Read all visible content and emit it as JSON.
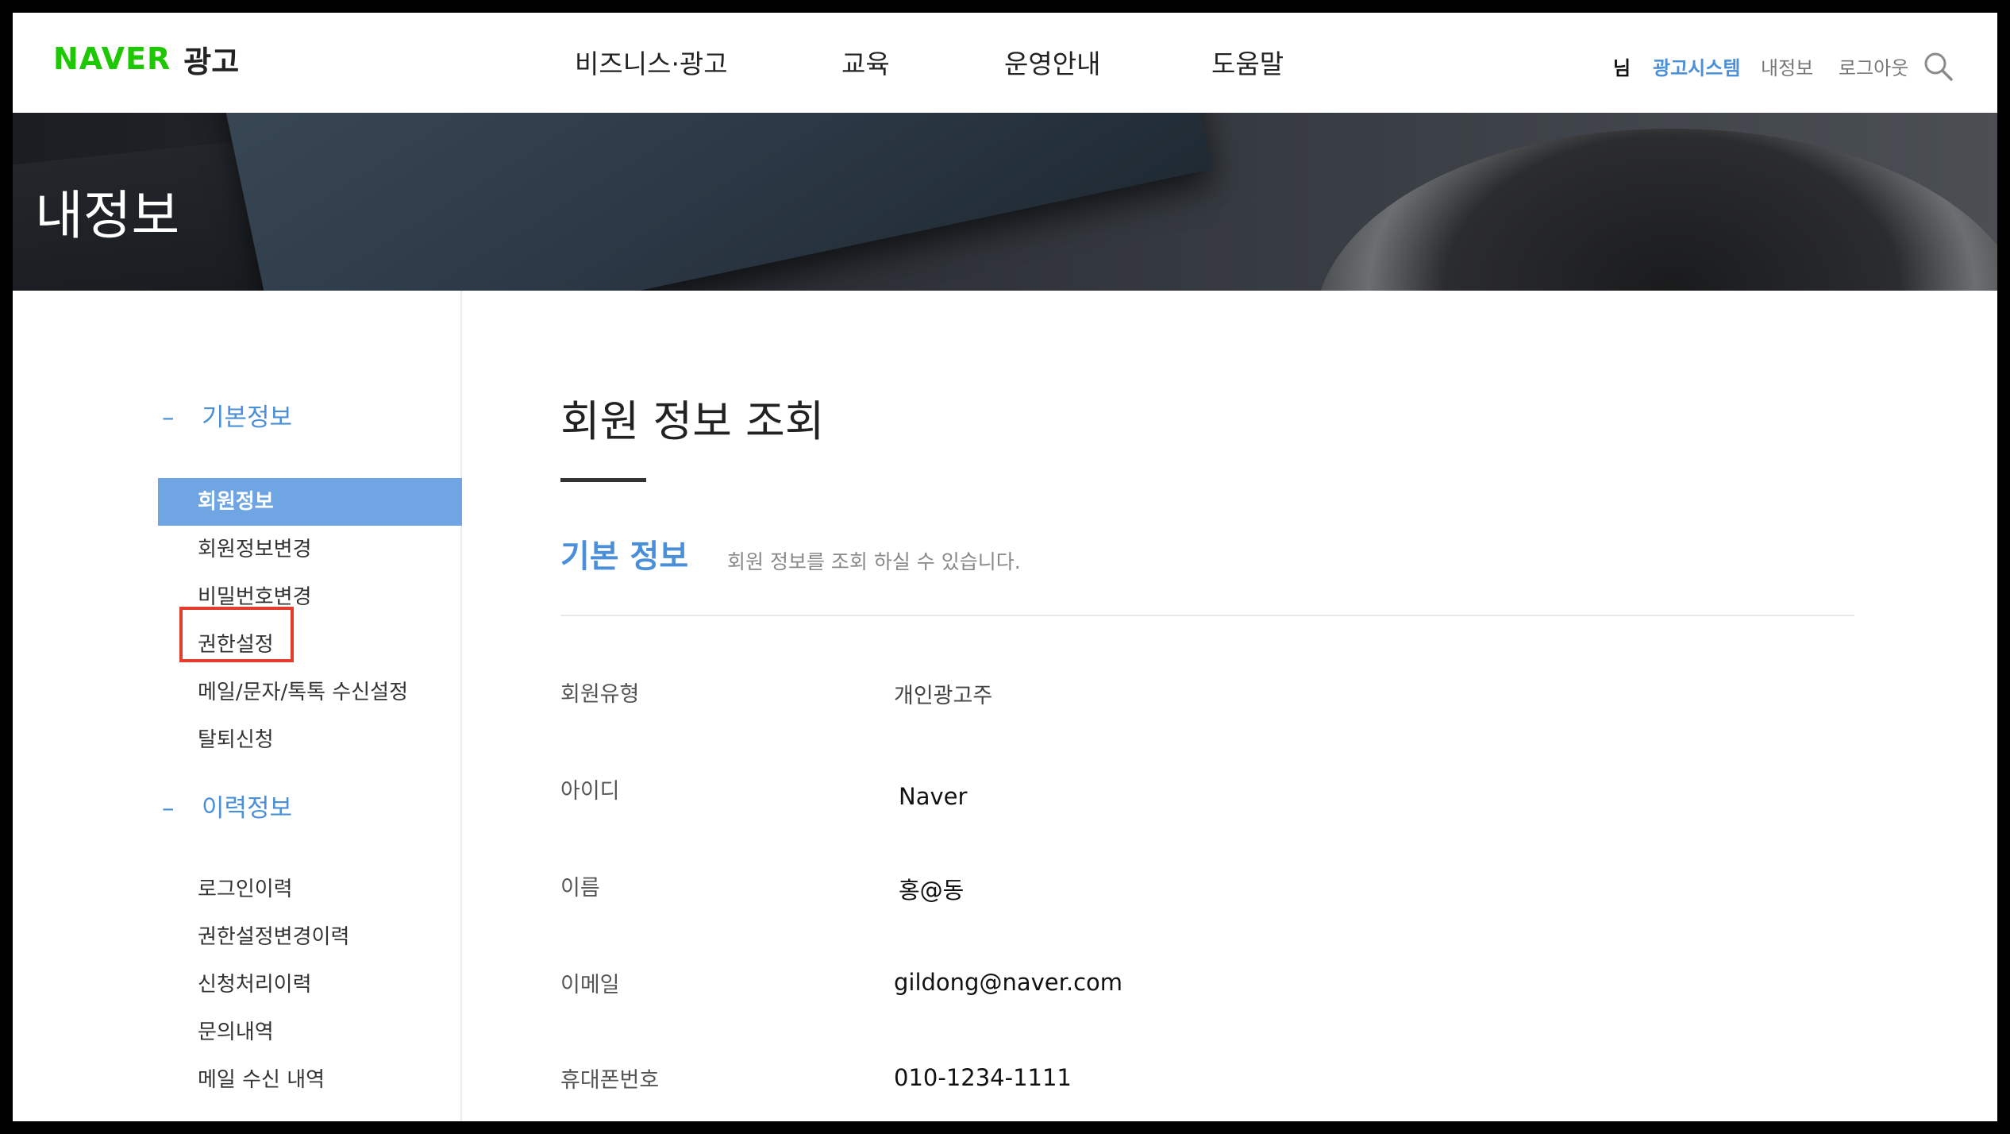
{
  "header": {
    "logo": {
      "brand": "NAVER",
      "service": "광고"
    },
    "gnb": [
      "비즈니스·광고",
      "교육",
      "운영안내",
      "도움말"
    ],
    "util": {
      "user": "님",
      "ad_system": "광고시스템",
      "my_info": "내정보",
      "logout": "로그아웃"
    }
  },
  "banner": {
    "title": "내정보"
  },
  "sidebar": {
    "basic_title": "기본정보",
    "basic_items": [
      "회원정보",
      "회원정보변경",
      "비밀번호변경",
      "권한설정",
      "메일/문자/톡톡 수신설정",
      "탈퇴신청"
    ],
    "history_title": "이력정보",
    "history_items": [
      "로그인이력",
      "권한설정변경이력",
      "신청처리이력",
      "문의내역",
      "메일 수신 내역"
    ],
    "dash": "–"
  },
  "content": {
    "page_title": "회원 정보 조회",
    "section_title": "기본 정보",
    "section_desc": "회원 정보를 조회 하실 수 있습니다.",
    "rows": [
      {
        "label": "회원유형",
        "value": "개인광고주"
      },
      {
        "label": "아이디",
        "value": "Naver"
      },
      {
        "label": "이름",
        "value": "홍@동"
      },
      {
        "label": "이메일",
        "value": "gildong@naver.com"
      },
      {
        "label": "휴대폰번호",
        "value": "010-1234-1111"
      }
    ]
  },
  "colors": {
    "brand_green": "#1ec800",
    "accent_blue": "#4a8fd8",
    "active_bg": "#6ea5e2",
    "highlight_red": "#e43d2b"
  }
}
